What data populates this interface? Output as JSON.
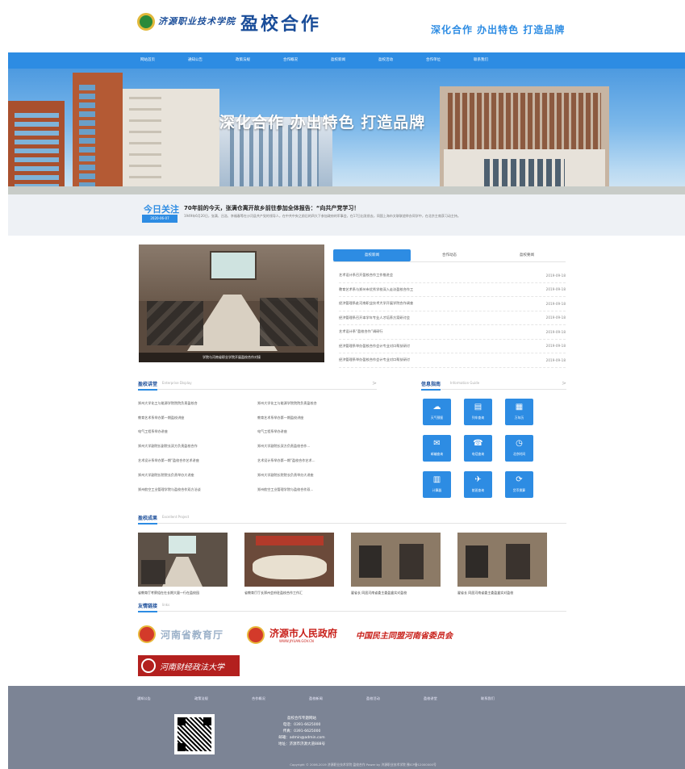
{
  "header": {
    "school_name": "济源职业技术学院",
    "site_title": "盈校合作",
    "slogan": "深化合作 办出特色 打造品牌"
  },
  "nav": [
    "网站首页",
    "通知公告",
    "政策法规",
    "合作概况",
    "盈校新闻",
    "盈校活动",
    "合作单位",
    "联系我们"
  ],
  "banner": {
    "title": "深化合作 办出特色 打造品牌"
  },
  "today": {
    "label": "今日关注",
    "date": "2020-06-07",
    "headline": "70年前的今天，张满仓离开故乡前往参加全体报告：“向共产党学习！",
    "summary": "1949年6月20日，张满、吕浩、李福春等在沙河县共产党的领导人，在中共中央之前后的四大下参加政府的军事会，在17日出发前去，同国上海市文联联谊举办同学中，在北京主席获习动主持。"
  },
  "featured_photo": {
    "caption": "学院与河南省职业学院开展盈校合作对接"
  },
  "tabs": [
    "盈校新闻",
    "合作动态",
    "盈校要闻"
  ],
  "tab_news": [
    {
      "title": "艺术设计系召开盈校合作工作推进会",
      "date": "2019-09-18"
    },
    {
      "title": "教育艺术系与郑州市优秀学校深入走访盈校合作工",
      "date": "2019-09-18"
    },
    {
      "title": "经济管理系赴河南职业技术大学开展学院合作调查",
      "date": "2019-09-18"
    },
    {
      "title": "经济管理系召开本学年专业人才培养方案研讨会",
      "date": "2019-09-18"
    },
    {
      "title": "艺术设计系“盈校合作”调研行",
      "date": "2019-09-18"
    },
    {
      "title": "经济管理系举办盈校合作会计专业对口帮扶研讨",
      "date": "2019-09-18"
    },
    {
      "title": "经济管理系举办盈校合作会计专业对口帮扶研讨",
      "date": "2019-09-18"
    }
  ],
  "projects": {
    "title": "盈校讲堂",
    "subtitle": "Enterprise Display",
    "more": ">",
    "rows": [
      [
        "郑州大学化工与能源学院院院负责盈校合",
        "郑州大学化工与能源学院院院负责盈校合"
      ],
      [
        "教育艺术系举办第一期盈校讲座",
        "教育艺术系举办第一期盈校讲座"
      ],
      [
        "电气工程系举办讲座",
        "电气工程系举办讲座"
      ],
      [
        "郑州大学副院长副院长双方负责盈校合作",
        "郑州大学副院长双方负责盈校合作..."
      ],
      [
        "艺术设计系举办第一期“盈校合作艺术讲座",
        "艺术设计系举办第一期“盈校合作艺术..."
      ],
      [
        "郑州大学副院长院院长负责举办大讲座",
        "郑州大学副院长院院长负责举办大讲座"
      ],
      [
        "郑州航空工业管理学院与盈校合作双方洽谈",
        "郑州航空工业管理学院与盈校合作双..."
      ]
    ]
  },
  "guide": {
    "title": "信息指南",
    "subtitle": "Information Guide",
    "more": ">",
    "items": [
      {
        "icon": "weather-icon",
        "glyph": "☁",
        "label": "天气预报"
      },
      {
        "icon": "train-icon",
        "glyph": "▤",
        "label": "列车查询"
      },
      {
        "icon": "calendar-icon",
        "glyph": "▦",
        "label": "万年历"
      },
      {
        "icon": "post-icon",
        "glyph": "✉",
        "label": "邮编查询"
      },
      {
        "icon": "phone-icon",
        "glyph": "☎",
        "label": "电话查询"
      },
      {
        "icon": "clock-icon",
        "glyph": "◷",
        "label": "北京时间"
      },
      {
        "icon": "calculator-icon",
        "glyph": "▥",
        "label": "计算器"
      },
      {
        "icon": "flight-icon",
        "glyph": "✈",
        "label": "航班查询"
      },
      {
        "icon": "exchange-icon",
        "glyph": "⟳",
        "label": "货币换算"
      }
    ]
  },
  "results": {
    "title": "盈校成果",
    "subtitle": "Excellent Project",
    "items": [
      {
        "caption": "省教育厅考察组在在长期大量一行在盈校园"
      },
      {
        "caption": "省教育厅厅长郑州会府驻盈校合作工作汇"
      },
      {
        "caption": "翟省长 同居河南省委主委盈盒实对盈校"
      },
      {
        "caption": "翟省长 同居河南省委主委盈盒实对盈校"
      }
    ]
  },
  "links": {
    "title": "友情链接",
    "subtitle": "links",
    "items": [
      {
        "name": "河南省教育厅"
      },
      {
        "name": "济源市人民政府",
        "sub": "WWW.JIYUAN.GOV.CN"
      },
      {
        "name": "中国民主同盟河南省委员会"
      },
      {
        "name": "河南财经政法大学"
      }
    ]
  },
  "footer": {
    "nav": [
      "通知公告",
      "政策法规",
      "合作概况",
      "盈校新闻",
      "盈校活动",
      "盈校讲堂",
      "联系我们"
    ],
    "contact": [
      "盈校合作专题网站",
      "电话：0391-6625000",
      "传真：0391-6625000",
      "邮箱：admin@admin.com",
      "地址：济源市济源大道888号"
    ],
    "copyright": "Copyright © 2006-2019 济源职业技术学院 盈校合作 Power by 济源职业技术学院 豫ICP备12000000号"
  },
  "colors": {
    "primary": "#2d8ce3",
    "title_blue": "#1a4d99",
    "footer_bg": "#7c8495"
  }
}
